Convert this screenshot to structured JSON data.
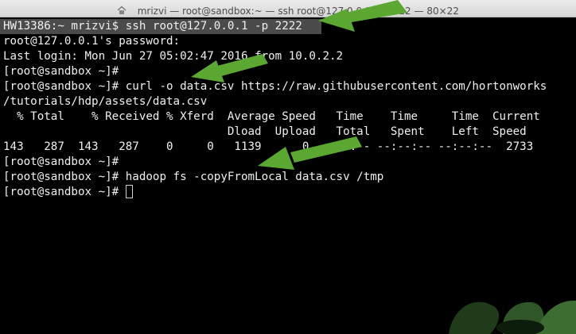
{
  "window": {
    "title": "mrizvi — root@sandbox:~ — ssh root@127.0.0.1 -p 2222 — 80×22",
    "icon": "home-icon"
  },
  "terminal": {
    "lines": [
      "HW13386:~ mrizvi$ ssh root@127.0.0.1 -p 2222",
      "root@127.0.0.1's password:",
      "Last login: Mon Jun 27 05:02:47 2016 from 10.0.2.2",
      "[root@sandbox ~]#",
      "[root@sandbox ~]# curl -o data.csv https://raw.githubusercontent.com/hortonworks",
      "/tutorials/hdp/assets/data.csv",
      "  % Total    % Received % Xferd  Average Speed   Time    Time     Time  Current",
      "                                 Dload  Upload   Total   Spent    Left  Speed",
      "143   287  143   287    0     0   1139      0 --:--:-- --:--:-- --:--:--  2733",
      "[root@sandbox ~]#",
      "[root@sandbox ~]# hadoop fs -copyFromLocal data.csv /tmp",
      "[root@sandbox ~]# "
    ]
  },
  "annotations": {
    "arrow_color": "#5aa832",
    "arrows": [
      "arrow-ssh",
      "arrow-curl",
      "arrow-hadoop"
    ]
  },
  "colors": {
    "background": "#000000",
    "foreground": "#f0f0f0",
    "highlight": "#4b4b4b"
  }
}
